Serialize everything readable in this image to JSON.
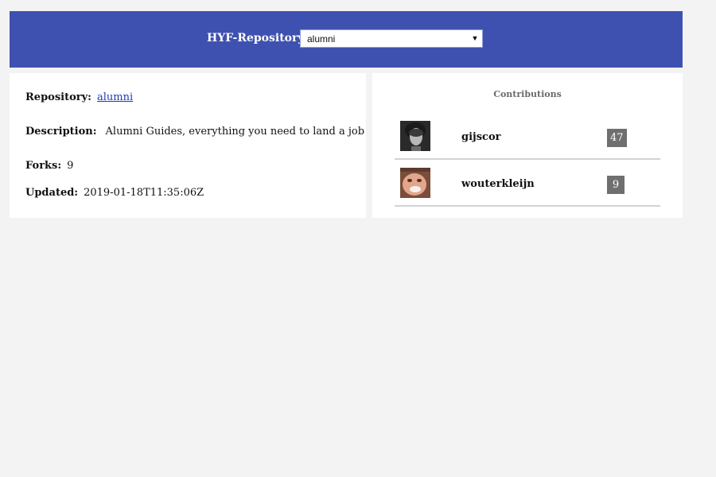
{
  "header": {
    "title": "HYF-Repository",
    "selected_repository": "alumni"
  },
  "repository": {
    "repo_label": "Repository:",
    "repo_name": "alumni",
    "description_label": "Description:",
    "description": "Alumni Guides, everything you need to land a job",
    "forks_label": "Forks:",
    "forks": "9",
    "updated_label": "Updated:",
    "updated": "2019-01-18T11:35:06Z"
  },
  "contributions": {
    "title": "Contributions",
    "items": [
      {
        "login": "gijscor",
        "count": "47"
      },
      {
        "login": "wouterkleijn",
        "count": "9"
      }
    ]
  },
  "colors": {
    "header_background": "#3f51b0",
    "page_background": "#f3f3f3",
    "count_badge": "#6f6f6f",
    "link": "#1a3cb8"
  }
}
